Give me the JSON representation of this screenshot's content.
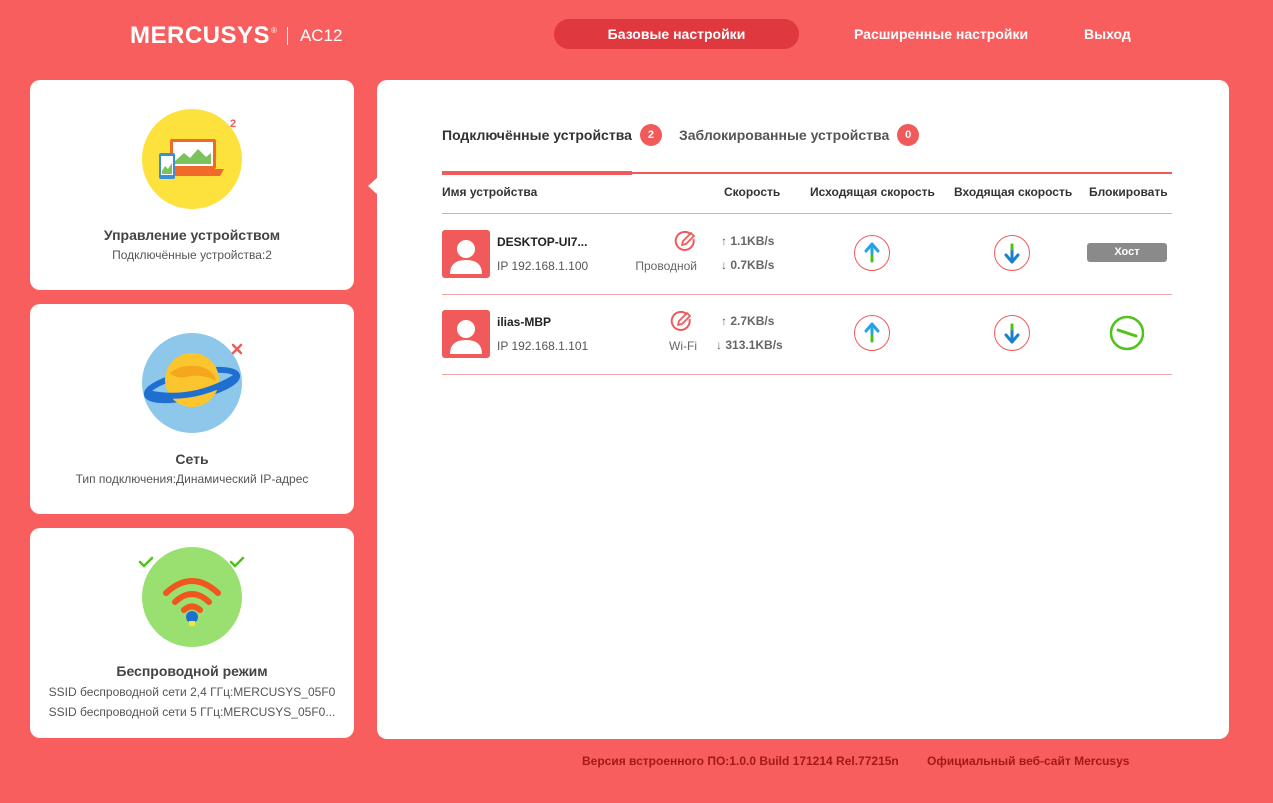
{
  "header": {
    "brand": "MERCUSYS",
    "reg": "®",
    "model": "AC12",
    "nav": {
      "basic": "Базовые настройки",
      "advanced": "Расширенные настройки",
      "exit": "Выход"
    }
  },
  "sidebar": {
    "device_mgmt": {
      "title": "Управление устройством",
      "subtitle": "Подключённые устройства:2",
      "badge": "2"
    },
    "network": {
      "title": "Сеть",
      "subtitle": "Тип подключения:Динамический IP-адрес"
    },
    "wireless": {
      "title": "Беспроводной режим",
      "ssid_24": "SSID беспроводной сети 2,4 ГГц:MERCUSYS_05F0",
      "ssid_5": "SSID беспроводной сети 5 ГГц:MERCUSYS_05F0..."
    }
  },
  "tabs": {
    "connected": {
      "label": "Подключённые устройства",
      "count": "2"
    },
    "blocked": {
      "label": "Заблокированные устройства",
      "count": "0"
    }
  },
  "table": {
    "headers": {
      "name": "Имя устройства",
      "speed": "Скорость",
      "upload": "Исходящая скорость",
      "download": "Входящая скорость",
      "block": "Блокировать"
    },
    "rows": [
      {
        "name": "DESKTOP-UI7...",
        "ip": "IP 192.168.1.100",
        "type": "Проводной",
        "up": "1.1KB/s",
        "down": "0.7KB/s",
        "block_label": "Хост"
      },
      {
        "name": "ilias-MBP",
        "ip": "IP 192.168.1.101",
        "type": "Wi-Fi",
        "up": "2.7KB/s",
        "down": "313.1KB/s"
      }
    ]
  },
  "footer": {
    "firmware": "Версия встроенного ПО:1.0.0 Build 171214 Rel.77215n",
    "website": "Официальный веб-сайт Mercusys"
  },
  "colors": {
    "background": "#f85e5e",
    "accent": "#f05a5a",
    "active_nav": "#e0383f",
    "up_arrow": "#25a3e0",
    "down_arrow": "#1a7fd0",
    "block_green": "#4fc31a"
  }
}
